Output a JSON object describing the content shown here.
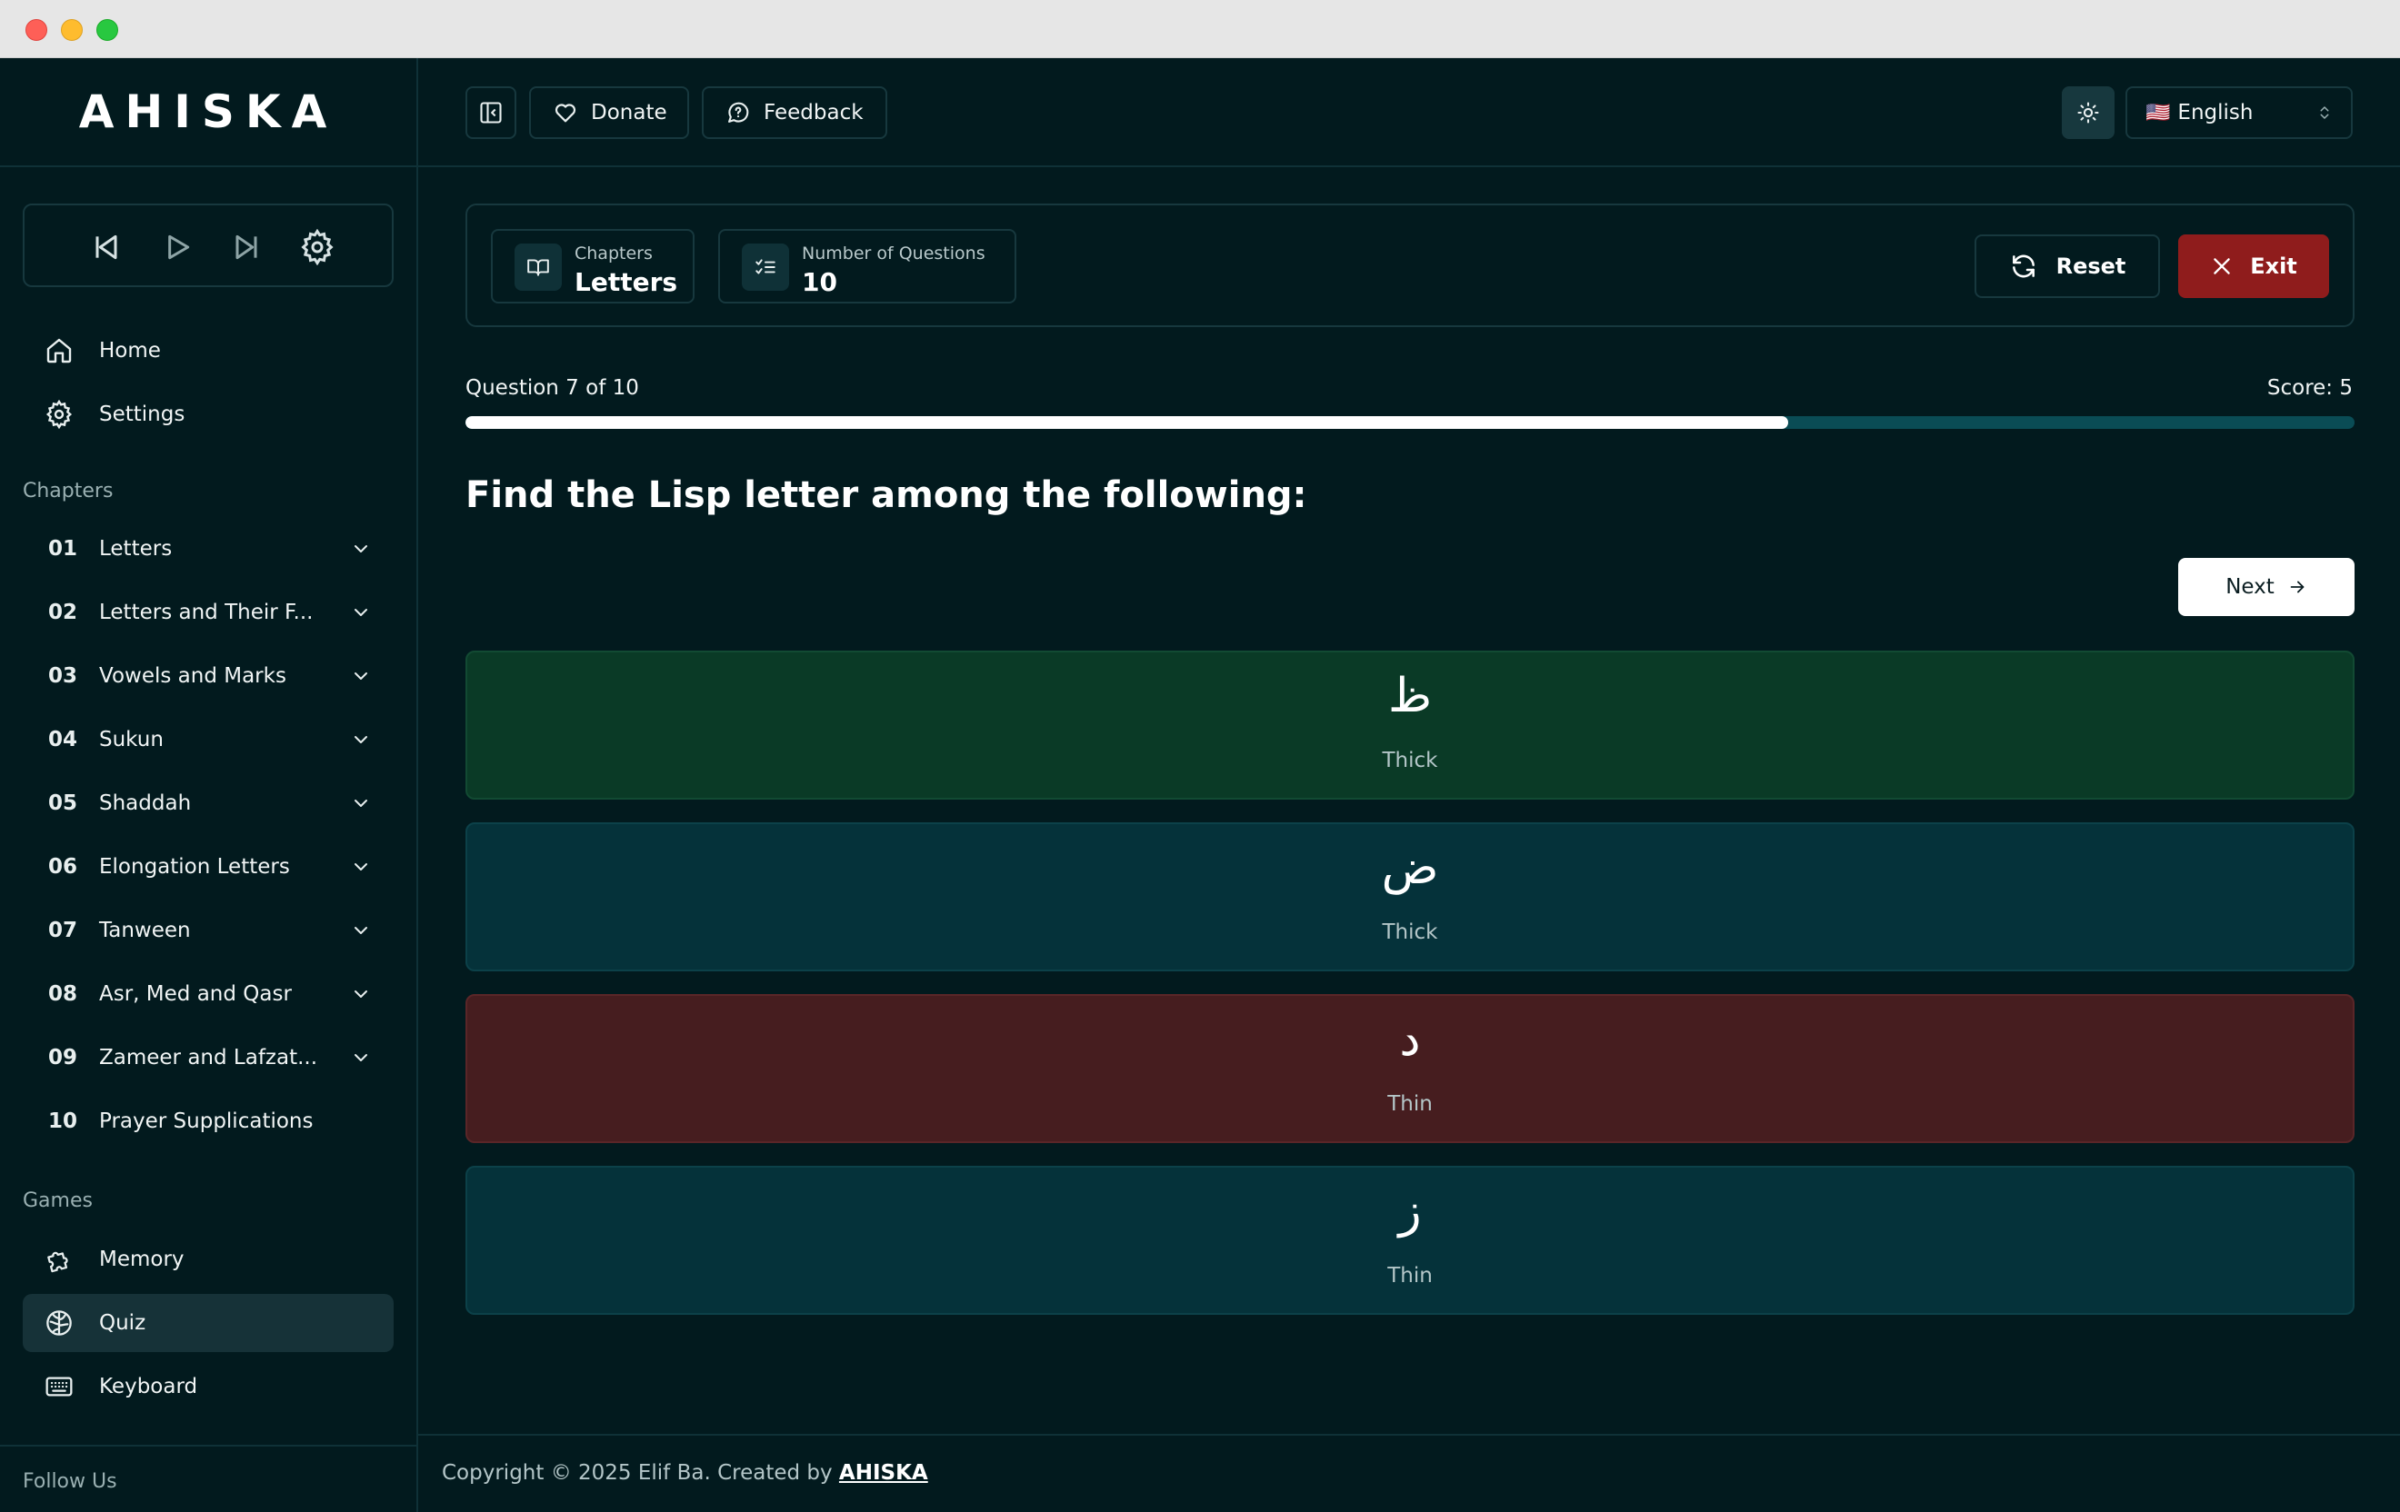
{
  "brand": {
    "name": "AHISKA"
  },
  "header": {
    "donate_label": "Donate",
    "feedback_label": "Feedback",
    "language_flag": "🇺🇸",
    "language": "English"
  },
  "sidebar": {
    "nav": [
      {
        "label": "Home",
        "icon": "home-icon"
      },
      {
        "label": "Settings",
        "icon": "gear-icon"
      }
    ],
    "chapters_heading": "Chapters",
    "chapters": [
      {
        "num": "01",
        "label": "Letters"
      },
      {
        "num": "02",
        "label": "Letters and Their F..."
      },
      {
        "num": "03",
        "label": "Vowels and Marks"
      },
      {
        "num": "04",
        "label": "Sukun"
      },
      {
        "num": "05",
        "label": "Shaddah"
      },
      {
        "num": "06",
        "label": "Elongation Letters"
      },
      {
        "num": "07",
        "label": "Tanween"
      },
      {
        "num": "08",
        "label": "Asr, Med and Qasr"
      },
      {
        "num": "09",
        "label": "Zameer and Lafzat..."
      },
      {
        "num": "10",
        "label": "Prayer Supplications"
      }
    ],
    "games_heading": "Games",
    "games": [
      {
        "label": "Memory",
        "icon": "puzzle-icon"
      },
      {
        "label": "Quiz",
        "icon": "brain-icon",
        "active": true
      },
      {
        "label": "Keyboard",
        "icon": "keyboard-icon"
      }
    ],
    "follow_us": "Follow Us"
  },
  "quiz": {
    "chapters_caption": "Chapters",
    "chapters_value": "Letters",
    "questions_caption": "Number of Questions",
    "questions_value": "10",
    "reset_label": "Reset",
    "exit_label": "Exit",
    "progress_text": "Question 7 of 10",
    "progress_fraction": 0.7,
    "score_text": "Score: 5",
    "question": "Find the Lisp letter among the following:",
    "next_label": "Next",
    "options": [
      {
        "letter": "ظ",
        "type": "Thick",
        "state": "correct"
      },
      {
        "letter": "ض",
        "type": "Thick",
        "state": "neutral"
      },
      {
        "letter": "د",
        "type": "Thin",
        "state": "wrong"
      },
      {
        "letter": "ز",
        "type": "Thin",
        "state": "neutral"
      }
    ]
  },
  "footer": {
    "copyright": "Copyright © 2025 Elif Ba. Created by ",
    "link": "AHISKA"
  },
  "colors": {
    "background": "#021a1e",
    "accent_exit": "#8f1c1c",
    "correct": "#0a3a26",
    "wrong": "#461d1f",
    "neutral": "#05323a"
  }
}
